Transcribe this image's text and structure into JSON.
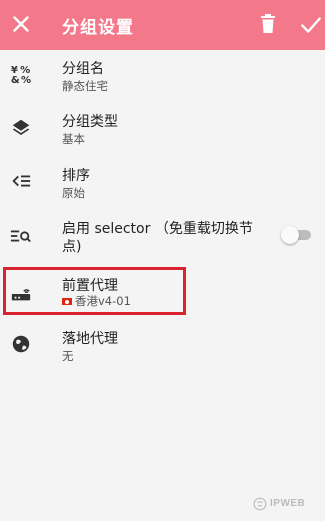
{
  "header": {
    "title": "分组设置",
    "close_icon": "close-icon",
    "delete_icon": "trash-icon",
    "confirm_icon": "check-icon",
    "color": "#f2788a"
  },
  "settings": [
    {
      "icon": "text-format-icon",
      "title": "分组名",
      "value": "静态住宅"
    },
    {
      "icon": "layers-icon",
      "title": "分组类型",
      "value": "基本"
    },
    {
      "icon": "sort-icon",
      "title": "排序",
      "value": "原始"
    },
    {
      "icon": "search-list-icon",
      "title": "启用 selector （免重载切换节",
      "title_line2": "点)",
      "toggle": false
    },
    {
      "icon": "router-icon",
      "title": "前置代理",
      "value": "香港v4-01",
      "flag": "hong-kong-flag"
    },
    {
      "icon": "globe-icon",
      "title": "落地代理",
      "value": "无"
    }
  ],
  "highlight_color": "#d9232f",
  "watermark": "IPWEB"
}
